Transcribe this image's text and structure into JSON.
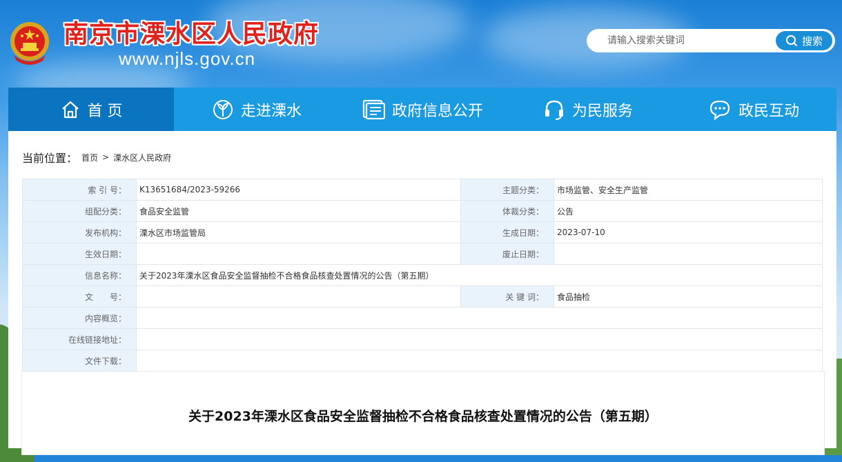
{
  "header": {
    "site_title": "南京市溧水区人民政府",
    "site_url": "www.njls.gov.cn",
    "emblem_icon": "national-emblem-icon"
  },
  "search": {
    "placeholder": "请输入搜索关键词",
    "button_label": "搜索"
  },
  "nav": {
    "items": [
      {
        "label": "首 页",
        "icon": "home-icon",
        "active": true
      },
      {
        "label": "走进溧水",
        "icon": "leaf-icon"
      },
      {
        "label": "政府信息公开",
        "icon": "document-icon"
      },
      {
        "label": "为民服务",
        "icon": "headset-icon"
      },
      {
        "label": "政民互动",
        "icon": "chat-icon"
      }
    ]
  },
  "breadcrumb": {
    "label": "当前位置：",
    "items": [
      "首页",
      "溧水区人民政府"
    ],
    "separator": ">"
  },
  "meta": {
    "index_no": {
      "label": "索 引 号：",
      "value": "K13651684/2023-59266"
    },
    "topic": {
      "label": "主题分类：",
      "value": "市场监管、安全生产监管"
    },
    "category": {
      "label": "组配分类：",
      "value": "食品安全监管"
    },
    "genre": {
      "label": "体裁分类：",
      "value": "公告"
    },
    "publisher": {
      "label": "发布机构：",
      "value": "溧水区市场监管局"
    },
    "created": {
      "label": "生成日期：",
      "value": "2023-07-10"
    },
    "effective": {
      "label": "生效日期：",
      "value": ""
    },
    "abolished": {
      "label": "废止日期：",
      "value": ""
    },
    "info_name": {
      "label": "信息名称：",
      "value": "关于2023年溧水区食品安全监督抽检不合格食品核查处置情况的公告（第五期）"
    },
    "doc_no": {
      "label": "文　　号：",
      "value": ""
    },
    "keywords": {
      "label": "关 键 词：",
      "value": "食品抽检"
    },
    "summary": {
      "label": "内容概览：",
      "value": ""
    },
    "online_link": {
      "label": "在线链接地址：",
      "value": ""
    },
    "download": {
      "label": "文件下载：",
      "value": ""
    }
  },
  "article": {
    "title": "关于2023年溧水区食品安全监督抽检不合格食品核查处置情况的公告（第五期）"
  },
  "colors": {
    "nav_bg": "#1a9ae0",
    "nav_active": "#0a74c0",
    "title_red": "#e0211c",
    "label_bg": "#e8f3fc"
  }
}
